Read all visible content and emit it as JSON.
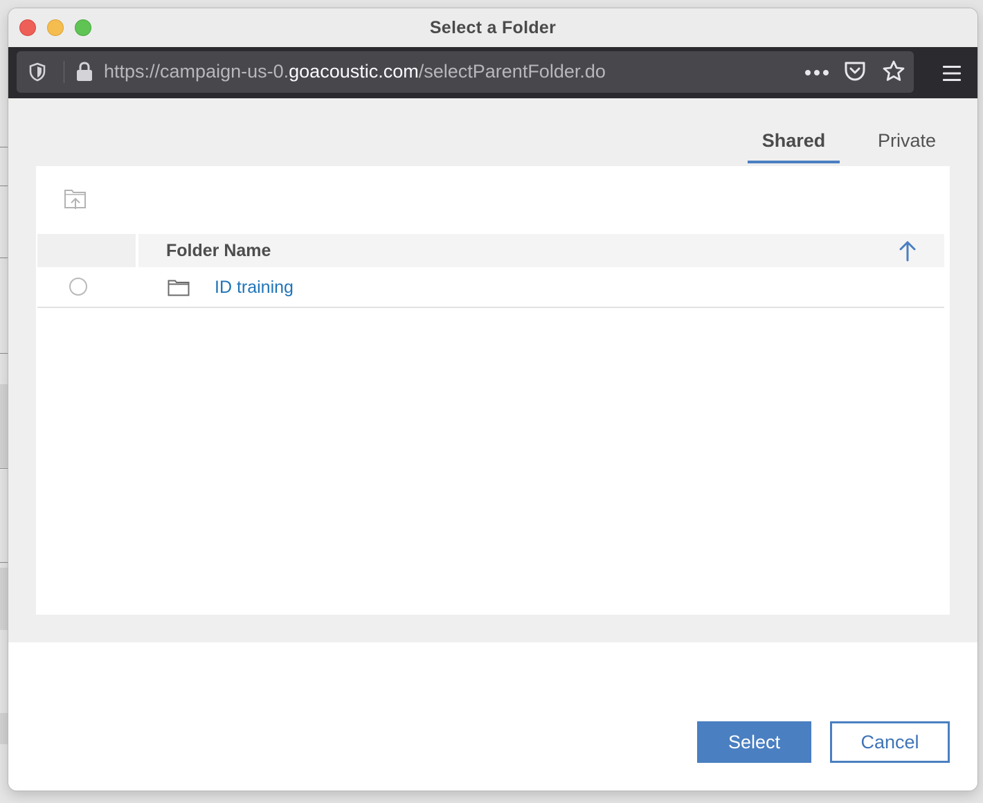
{
  "window": {
    "title": "Select a Folder"
  },
  "browser": {
    "url_prefix": "https://campaign-us-0.",
    "url_domain": "goacoustic.com",
    "url_path": "/selectParentFolder.do",
    "icons": [
      "shield-icon",
      "lock-icon",
      "more-icon",
      "pocket-icon",
      "bookmark-star-icon",
      "menu-icon"
    ]
  },
  "tabs": [
    {
      "label": "Shared",
      "active": true
    },
    {
      "label": "Private",
      "active": false
    }
  ],
  "table": {
    "column_header": "Folder Name",
    "sort_direction": "ascending",
    "rows": [
      {
        "name": "ID training",
        "selected": false
      }
    ]
  },
  "buttons": {
    "select_label": "Select",
    "cancel_label": "Cancel"
  },
  "colors": {
    "accent": "#4a7fc1",
    "link": "#1f74b8",
    "toolbar": "#2b2a2e"
  }
}
